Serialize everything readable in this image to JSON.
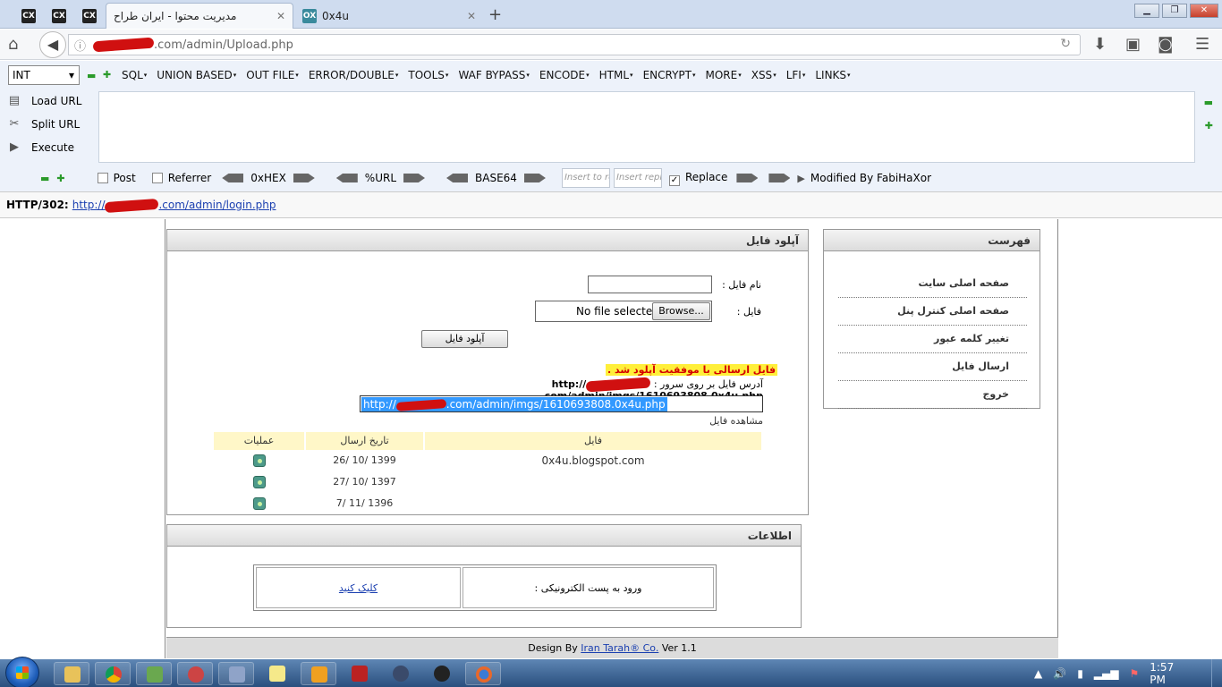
{
  "tabs": {
    "pinned": [
      "CX",
      "CX",
      "CX"
    ],
    "active_title": "مدیریت محتوا - ایران طراح",
    "second_favicon": "OX",
    "second_title": "0x4u",
    "close_glyph": "✕",
    "new_tab_glyph": "+"
  },
  "window": {
    "min": "▁",
    "max": "❐",
    "close": "✕"
  },
  "nav": {
    "url_suffix": ".com/admin/Upload.php",
    "info_glyph": "ⓘ",
    "reload_glyph": "↻"
  },
  "hackbar": {
    "select_value": "INT",
    "menu": [
      "SQL",
      "UNION BASED",
      "OUT FILE",
      "ERROR/DOUBLE",
      "TOOLS",
      "WAF BYPASS",
      "ENCODE",
      "HTML",
      "ENCRYPT",
      "MORE",
      "XSS",
      "LFI",
      "LINKS"
    ],
    "load_url": "Load URL",
    "split_url": "Split URL",
    "execute": "Execute",
    "post": "Post",
    "referrer": "Referrer",
    "hex": "0xHEX",
    "url_enc": "%URL",
    "base64": "BASE64",
    "insert_to": "Insert to rep",
    "insert_replace": "Insert repla",
    "replace": "Replace",
    "modified_by": "Modified By FabiHaXor"
  },
  "status": {
    "code": "HTTP/302:",
    "link_prefix": "http://",
    "link_suffix": ".com/admin/login.php"
  },
  "page": {
    "menu_title": "فهرست",
    "menu_items": [
      "صفحه اصلی سایت",
      "صفحه اصلی کنترل پنل",
      "تغییر کلمه عبور",
      "ارسال فایل",
      "خروج"
    ],
    "upload_title": "آپلود فایل",
    "file_name_label": "نام فایل :",
    "file_label": "فایل :",
    "no_file": "No file selected.",
    "browse": "Browse...",
    "upload_button": "آپلود فایل",
    "success_msg": "فایل ارسالی با موفقیت آپلود شد .",
    "server_path_label": "آدرس فایل بر روی سرور :",
    "server_path_prefix": "http://",
    "server_path_suffix": ".com/admin/imgs/1610693808.0x4u.php",
    "selected_url_prefix": "http://",
    "selected_url_suffix": ".com/admin/imgs/1610693808.0x4u.php",
    "view_file": "مشاهده فایل",
    "table": {
      "headers": [
        "فایل",
        "تاریخ ارسال",
        "عملیات"
      ],
      "rows": [
        {
          "file": "0x4u.blogspot.com",
          "date": "26/ 10/ 1399"
        },
        {
          "file": "",
          "date": "27/ 10/ 1397"
        },
        {
          "file": "",
          "date": "7/ 11/ 1396"
        }
      ]
    },
    "info_title": "اطلاعات",
    "email_login": "ورود به پست الکترونیکی :",
    "click_here": "کلیک کنید",
    "footer_prefix": "Design By",
    "footer_link": "Iran Tarah® Co.",
    "footer_suffix": "Ver 1.1"
  },
  "taskbar": {
    "clock": "1:57 PM"
  }
}
